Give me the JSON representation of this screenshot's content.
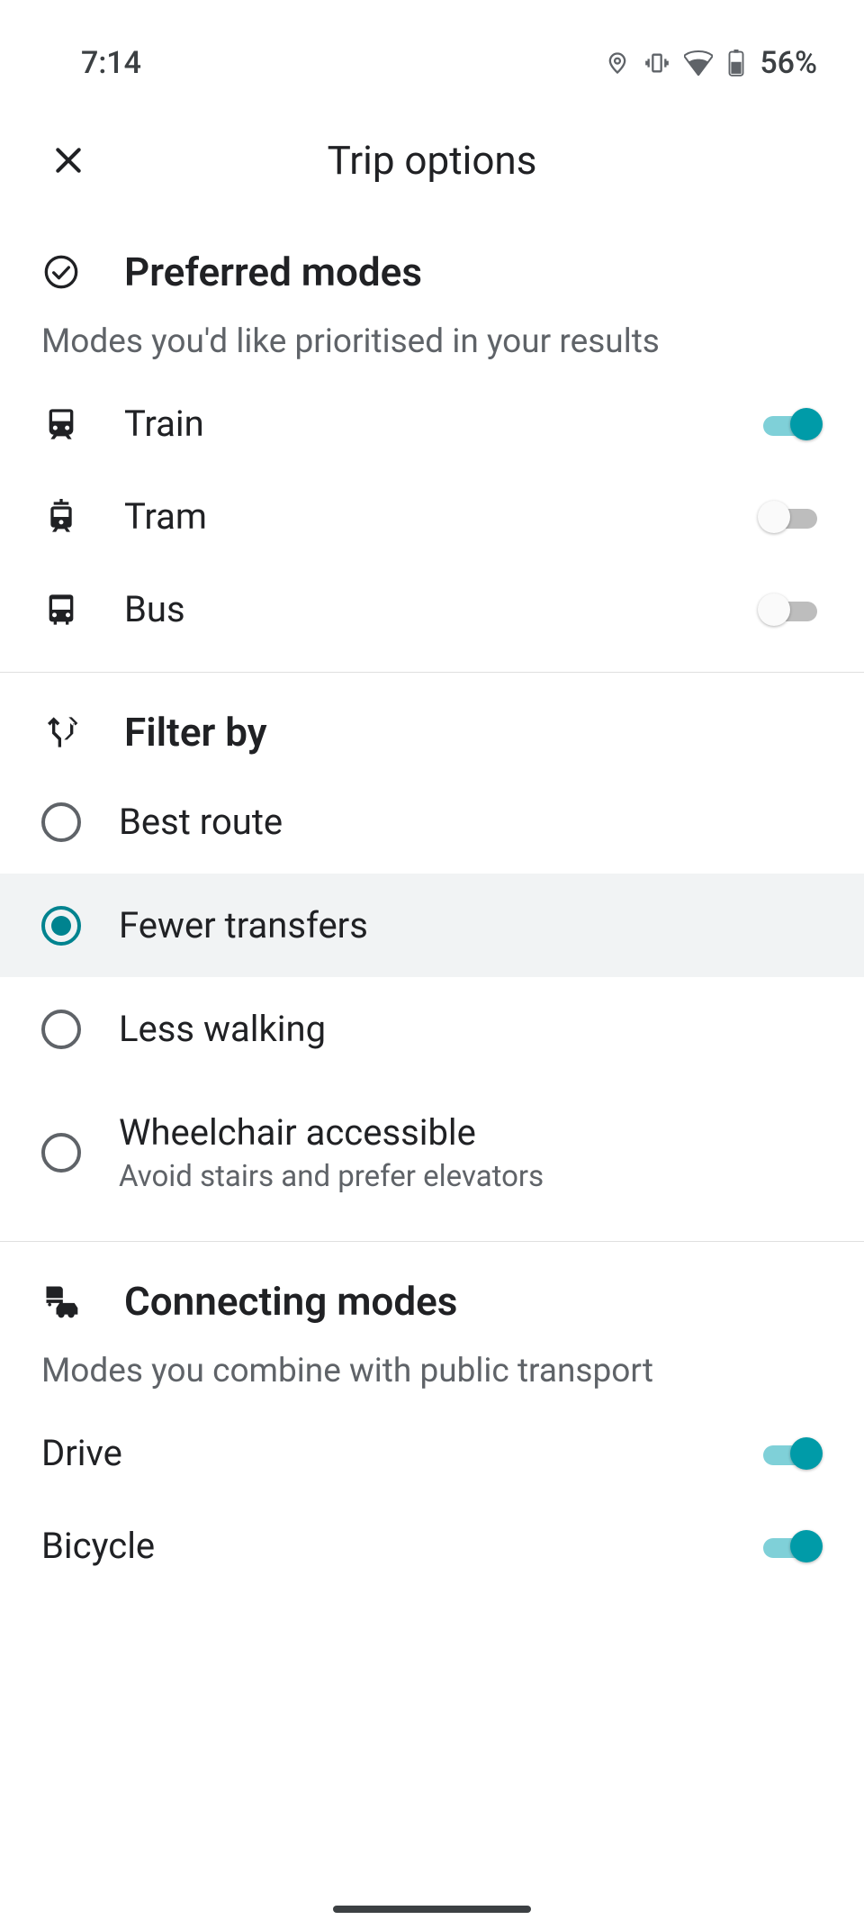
{
  "statusbar": {
    "time": "7:14",
    "battery_pct": "56%"
  },
  "header": {
    "title": "Trip options"
  },
  "preferred": {
    "title": "Preferred modes",
    "subtitle": "Modes you'd like prioritised in your results",
    "items": [
      {
        "label": "Train",
        "enabled": true
      },
      {
        "label": "Tram",
        "enabled": false
      },
      {
        "label": "Bus",
        "enabled": false
      }
    ]
  },
  "filter": {
    "title": "Filter by",
    "options": [
      {
        "label": "Best route",
        "selected": false
      },
      {
        "label": "Fewer transfers",
        "selected": true
      },
      {
        "label": "Less walking",
        "selected": false
      },
      {
        "label": "Wheelchair accessible",
        "sublabel": "Avoid stairs and prefer elevators",
        "selected": false
      }
    ]
  },
  "connecting": {
    "title": "Connecting modes",
    "subtitle": "Modes you combine with public transport",
    "items": [
      {
        "label": "Drive",
        "enabled": true
      },
      {
        "label": "Bicycle",
        "enabled": true
      }
    ]
  }
}
